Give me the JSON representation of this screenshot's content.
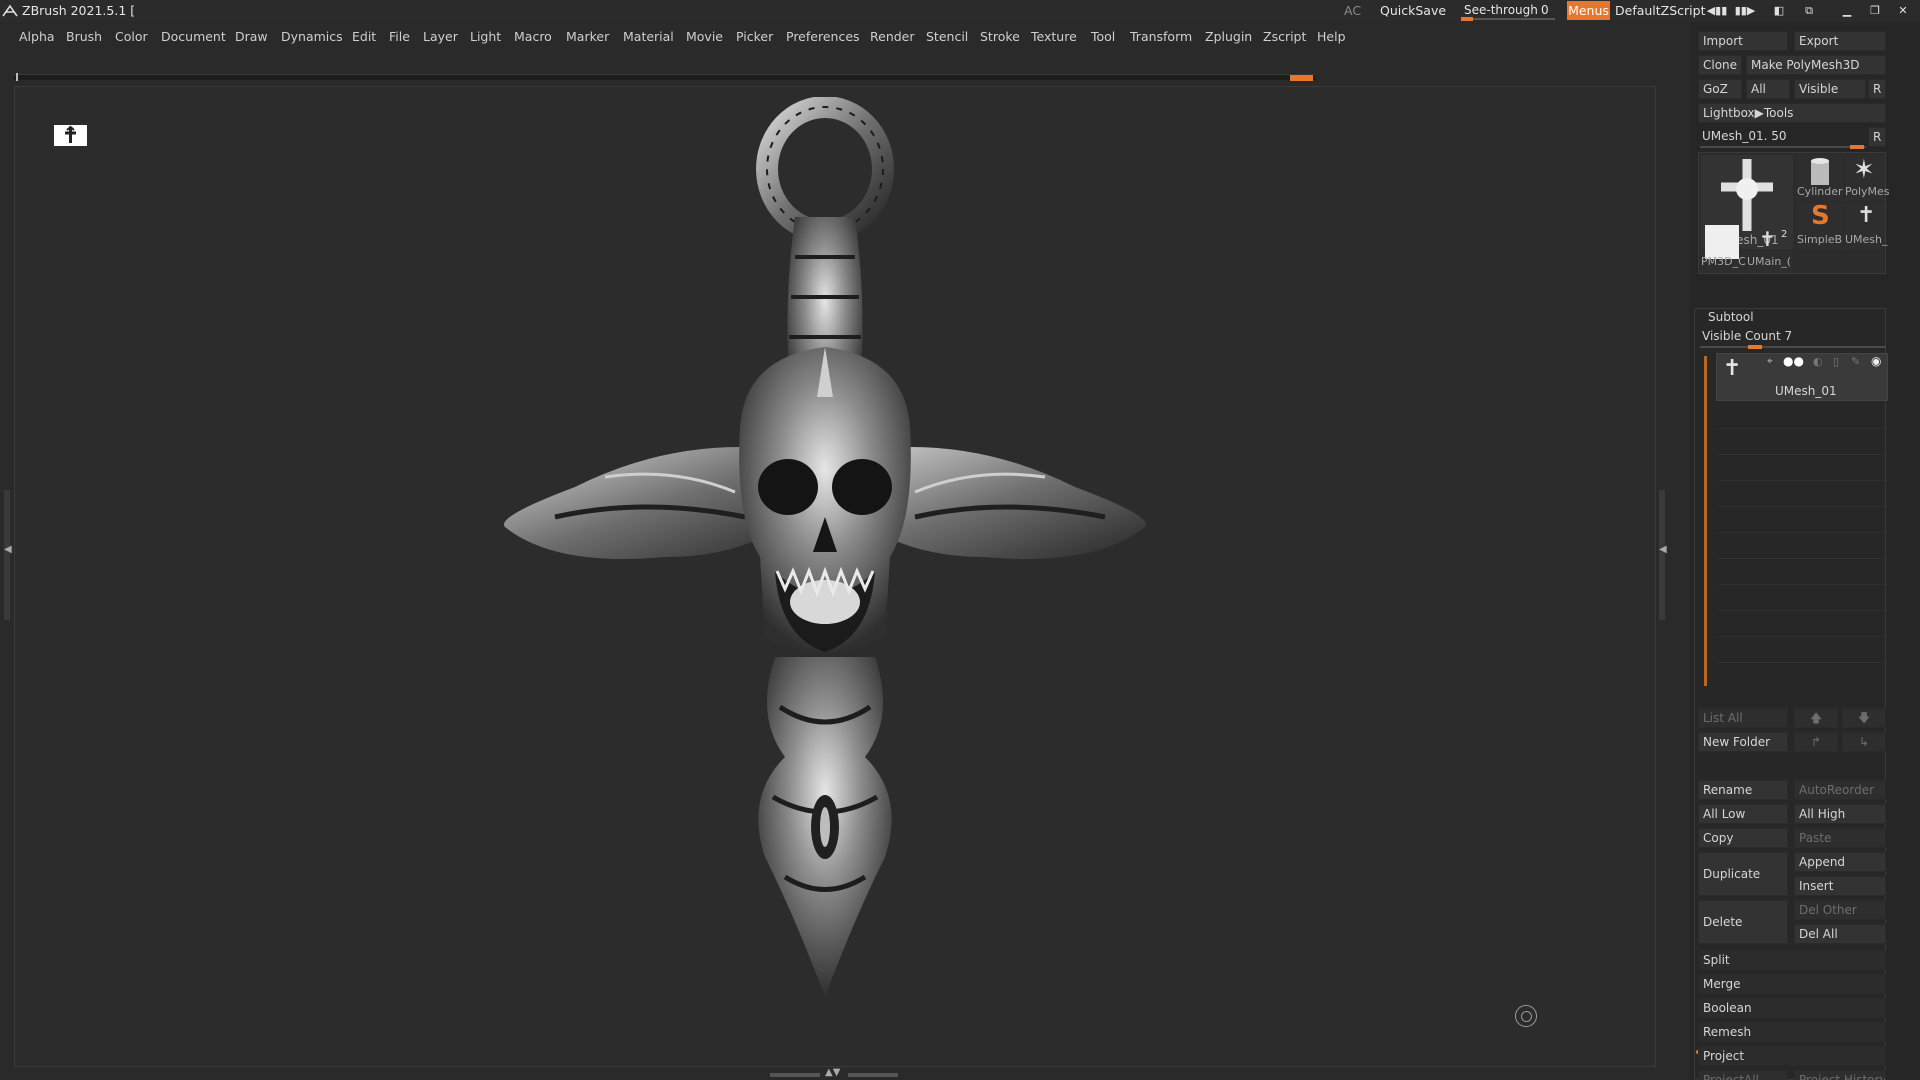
{
  "titlebar": {
    "app_title": "ZBrush 2021.5.1 [",
    "ac": "AC",
    "quicksave": "QuickSave",
    "seethrough_label": "See-through",
    "seethrough_value": "0",
    "menus": "Menus",
    "zscript": "DefaultZScript",
    "accent": "#e8772e"
  },
  "menubar": {
    "items": [
      "Alpha",
      "Brush",
      "Color",
      "Document",
      "Draw",
      "Dynamics",
      "Edit",
      "File",
      "Layer",
      "Light",
      "Macro",
      "Marker",
      "Material",
      "Movie",
      "Picker",
      "Preferences",
      "Render",
      "Stencil",
      "Stroke",
      "Texture",
      "Tool",
      "Transform",
      "Zplugin",
      "Zscript",
      "Help"
    ]
  },
  "tray": {
    "import": "Import",
    "export": "Export",
    "clone": "Clone",
    "make_polymesh": "Make PolyMesh3D",
    "goz": "GoZ",
    "all": "All",
    "visible": "Visible",
    "r": "R",
    "lightbox_tools": "Lightbox▶Tools",
    "tool_slider_label": "UMesh_01. 50",
    "tools": {
      "main": "UMesh_01",
      "cylinder": "Cylinder",
      "polymesh": "PolyMes",
      "simpleb": "SimpleB",
      "umesh": "UMesh_",
      "pm3d": "PM3D_C",
      "umain": "UMain_(",
      "badge": "2"
    },
    "subtool": {
      "title": "Subtool",
      "visible_count": "Visible Count 7",
      "item_name": "UMesh_01"
    },
    "buttons": {
      "list_all": "List All",
      "new_folder": "New Folder",
      "rename": "Rename",
      "autoreorder": "AutoReorder",
      "all_low": "All Low",
      "all_high": "All High",
      "copy": "Copy",
      "paste": "Paste",
      "duplicate": "Duplicate",
      "append": "Append",
      "insert": "Insert",
      "delete": "Delete",
      "del_other": "Del Other",
      "del_all": "Del All",
      "split": "Split",
      "merge": "Merge",
      "boolean": "Boolean",
      "remesh": "Remesh",
      "project": "Project",
      "project_all": "ProjectAll",
      "project_history": "Project History"
    }
  }
}
